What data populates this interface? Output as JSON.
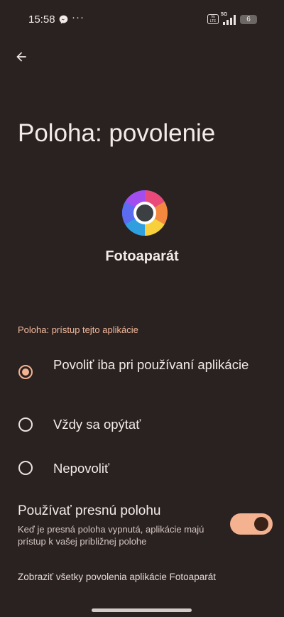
{
  "status_bar": {
    "time": "15:58",
    "messenger_icon": "messenger-icon",
    "more_dots": "···",
    "volte": "Vo LTE",
    "network": "5G",
    "battery": "6"
  },
  "header": {
    "back_icon": "arrow-back-icon",
    "title": "Poloha: povolenie"
  },
  "app": {
    "name": "Fotoaparát",
    "icon": "camera-app-icon"
  },
  "section": {
    "header": "Poloha: prístup tejto aplikácie"
  },
  "options": [
    {
      "label": "Povoliť iba pri používaní aplikácie",
      "selected": true
    },
    {
      "label": "Vždy sa opýtať",
      "selected": false
    },
    {
      "label": "Nepovoliť",
      "selected": false
    }
  ],
  "precise": {
    "title": "Používať presnú polohu",
    "description": "Keď je presná poloha vypnutá, aplikácie majú prístup k vašej približnej polohe",
    "enabled": true
  },
  "footer": {
    "all_permissions_link": "Zobraziť všetky povolenia aplikácie Fotoaparát"
  },
  "colors": {
    "background": "#2a2220",
    "accent": "#f4b291",
    "section_header": "#f0b89c"
  }
}
